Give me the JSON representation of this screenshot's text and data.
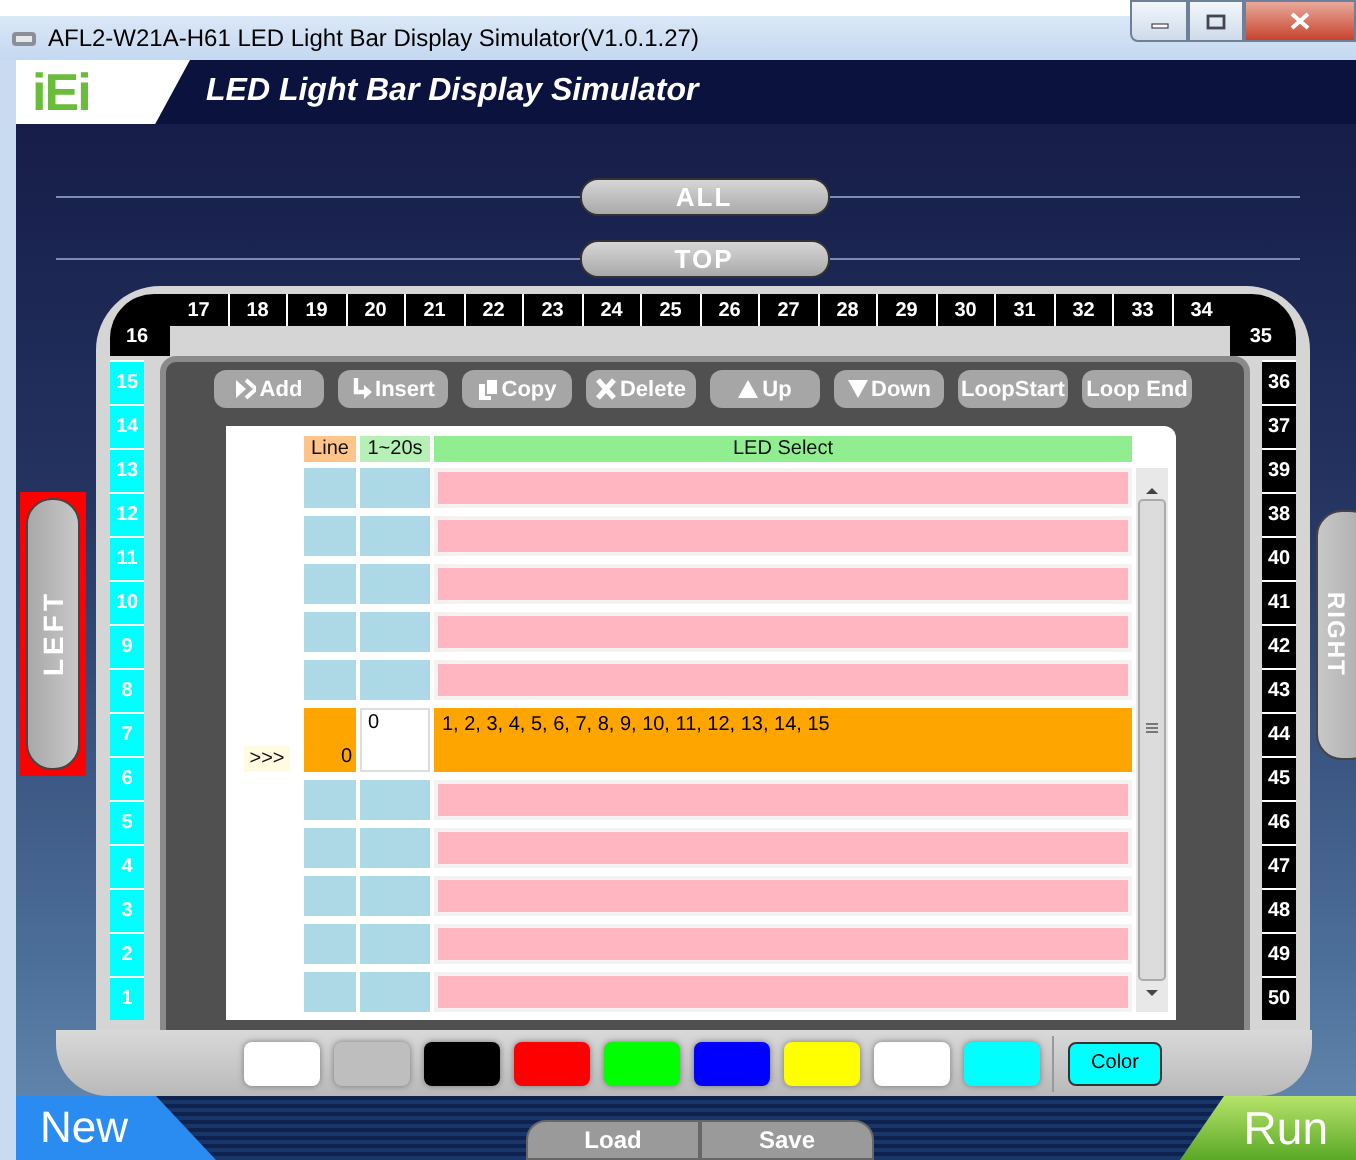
{
  "window": {
    "title": "AFL2-W21A-H61 LED Light Bar Display Simulator(V1.0.1.27)"
  },
  "header": {
    "logo": "iEi",
    "title": "LED Light Bar Display Simulator"
  },
  "zones": [
    {
      "label": "ALL",
      "selected": false
    },
    {
      "label": "TOP",
      "selected": false
    }
  ],
  "side_buttons": [
    {
      "label": "LEFT",
      "selected": true
    },
    {
      "label": "RIGHT",
      "selected": false
    }
  ],
  "led_strip": {
    "top": [
      {
        "label": "16",
        "lit": false
      },
      {
        "label": "17",
        "lit": false
      },
      {
        "label": "18",
        "lit": false
      },
      {
        "label": "19",
        "lit": false
      },
      {
        "label": "20",
        "lit": false
      },
      {
        "label": "21",
        "lit": false
      },
      {
        "label": "22",
        "lit": false
      },
      {
        "label": "23",
        "lit": false
      },
      {
        "label": "24",
        "lit": false
      },
      {
        "label": "25",
        "lit": false
      },
      {
        "label": "26",
        "lit": false
      },
      {
        "label": "27",
        "lit": false
      },
      {
        "label": "28",
        "lit": false
      },
      {
        "label": "29",
        "lit": false
      },
      {
        "label": "30",
        "lit": false
      },
      {
        "label": "31",
        "lit": false
      },
      {
        "label": "32",
        "lit": false
      },
      {
        "label": "33",
        "lit": false
      },
      {
        "label": "34",
        "lit": false
      },
      {
        "label": "35",
        "lit": false
      }
    ],
    "left": [
      {
        "label": "15",
        "lit": true
      },
      {
        "label": "14",
        "lit": true
      },
      {
        "label": "13",
        "lit": true
      },
      {
        "label": "12",
        "lit": true
      },
      {
        "label": "11",
        "lit": true
      },
      {
        "label": "10",
        "lit": true
      },
      {
        "label": "9",
        "lit": true
      },
      {
        "label": "8",
        "lit": true
      },
      {
        "label": "7",
        "lit": true
      },
      {
        "label": "6",
        "lit": true
      },
      {
        "label": "5",
        "lit": true
      },
      {
        "label": "4",
        "lit": true
      },
      {
        "label": "3",
        "lit": true
      },
      {
        "label": "2",
        "lit": true
      },
      {
        "label": "1",
        "lit": true
      }
    ],
    "right": [
      {
        "label": "36",
        "lit": false
      },
      {
        "label": "37",
        "lit": false
      },
      {
        "label": "39",
        "lit": false
      },
      {
        "label": "38",
        "lit": false
      },
      {
        "label": "40",
        "lit": false
      },
      {
        "label": "41",
        "lit": false
      },
      {
        "label": "42",
        "lit": false
      },
      {
        "label": "43",
        "lit": false
      },
      {
        "label": "44",
        "lit": false
      },
      {
        "label": "45",
        "lit": false
      },
      {
        "label": "46",
        "lit": false
      },
      {
        "label": "47",
        "lit": false
      },
      {
        "label": "48",
        "lit": false
      },
      {
        "label": "49",
        "lit": false
      },
      {
        "label": "50",
        "lit": false
      }
    ]
  },
  "toolbar": [
    {
      "label": "Add",
      "kind": "add"
    },
    {
      "label": "Insert",
      "kind": "insert"
    },
    {
      "label": "Copy",
      "kind": "copy"
    },
    {
      "label": "Delete",
      "kind": "delete"
    },
    {
      "label": "Up",
      "kind": "up"
    },
    {
      "label": "Down",
      "kind": "down"
    },
    {
      "label": "LoopStart",
      "kind": "text"
    },
    {
      "label": "Loop End",
      "kind": "text"
    }
  ],
  "table": {
    "columns": [
      "Line",
      "1~20s",
      "LED Select"
    ],
    "rows": [
      {
        "selected": false
      },
      {
        "selected": false
      },
      {
        "selected": false
      },
      {
        "selected": false
      },
      {
        "selected": false
      },
      {
        "selected": true,
        "marker": ">>>",
        "line": "0",
        "duration": "0",
        "leds": "1, 2, 3, 4, 5, 6, 7, 8, 9, 10, 11, 12, 13, 14, 15"
      },
      {
        "selected": false
      },
      {
        "selected": false
      },
      {
        "selected": false
      },
      {
        "selected": false
      },
      {
        "selected": false
      }
    ]
  },
  "palette": [
    {
      "color": "#ffffff"
    },
    {
      "color": "#bebebe"
    },
    {
      "color": "#000000"
    },
    {
      "color": "#ff0000"
    },
    {
      "color": "#00ff00"
    },
    {
      "color": "#0000ff"
    },
    {
      "color": "#ffff00"
    },
    {
      "color": "#ffffff"
    },
    {
      "color": "#00ffff"
    }
  ],
  "color_button": {
    "label": "Color",
    "color": "#00ffff"
  },
  "footer": {
    "new": "New",
    "load": "Load",
    "save": "Save",
    "run": "Run"
  }
}
